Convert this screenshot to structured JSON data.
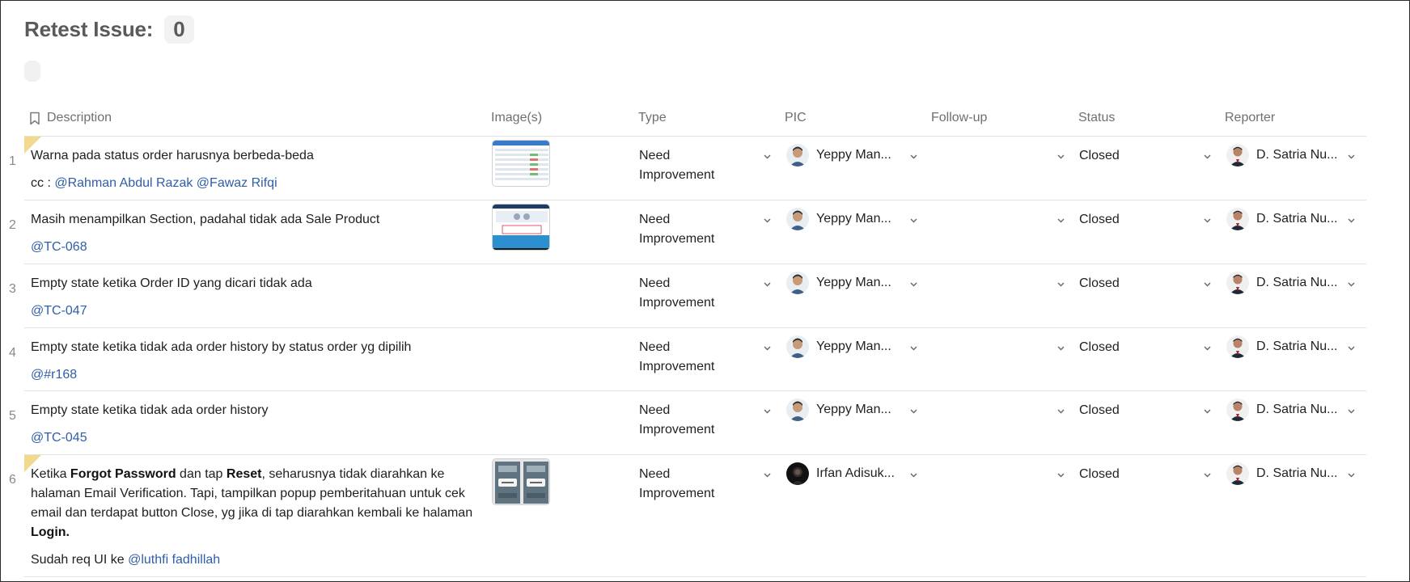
{
  "header": {
    "title": "Retest Issue:",
    "count": "0"
  },
  "columns": {
    "description": "Description",
    "images": "Image(s)",
    "type": "Type",
    "pic": "PIC",
    "followup": "Follow-up",
    "status": "Status",
    "reporter": "Reporter"
  },
  "rows": [
    {
      "num": "1",
      "desc_line1": "Warna pada status order harusnya berbeda-beda",
      "desc_prefix": "cc : ",
      "mention_a": "@Rahman Abdul Razak",
      "mention_b": "@Fawaz Rifqi",
      "type_a": "Need",
      "type_b": "Improvement",
      "pic": "Yeppy Man...",
      "followup": "",
      "status": "Closed",
      "reporter": "D. Satria Nu..."
    },
    {
      "num": "2",
      "desc_line1": "Masih menampilkan Section, padahal tidak ada Sale Product",
      "mention_a": "@TC-068",
      "type_a": "Need",
      "type_b": "Improvement",
      "pic": "Yeppy Man...",
      "followup": "",
      "status": "Closed",
      "reporter": "D. Satria Nu..."
    },
    {
      "num": "3",
      "desc_line1": "Empty state ketika Order ID yang dicari tidak ada",
      "mention_a": "@TC-047",
      "type_a": "Need",
      "type_b": "Improvement",
      "pic": "Yeppy Man...",
      "followup": "",
      "status": "Closed",
      "reporter": "D. Satria Nu..."
    },
    {
      "num": "4",
      "desc_line1": "Empty state ketika tidak ada order history by status order yg dipilih",
      "mention_a": "@#r168",
      "type_a": "Need",
      "type_b": "Improvement",
      "pic": "Yeppy Man...",
      "followup": "",
      "status": "Closed",
      "reporter": "D. Satria Nu..."
    },
    {
      "num": "5",
      "desc_line1": "Empty state ketika tidak ada order history",
      "mention_a": "@TC-045",
      "type_a": "Need",
      "type_b": "Improvement",
      "pic": "Yeppy Man...",
      "followup": "",
      "status": "Closed",
      "reporter": "D. Satria Nu..."
    },
    {
      "num": "6",
      "seg1": "Ketika ",
      "seg2": "Forgot Password",
      "seg3": " dan tap ",
      "seg4": "Reset",
      "seg5": ", seharusnya tidak diarahkan ke halaman Email Verification. Tapi, tampilkan popup pemberitahuan untuk cek email dan terdapat button Close, yg jika di tap diarahkan kembali ke halaman ",
      "seg6": "Login.",
      "desc_prefix": "Sudah req UI ke ",
      "mention_a": "@luthfi fadhillah",
      "type_a": "Need",
      "type_b": "Improvement",
      "pic": "Irfan Adisuk...",
      "followup": "",
      "status": "Closed",
      "reporter": "D. Satria Nu..."
    }
  ],
  "icons": {
    "description_header": "bookmark-icon",
    "dropdown": "chevron-down-icon",
    "avatar": "avatar"
  },
  "colors": {
    "mention": "#2f5ea8",
    "flag": "#f2d98d",
    "divider": "#e3e3e3"
  }
}
